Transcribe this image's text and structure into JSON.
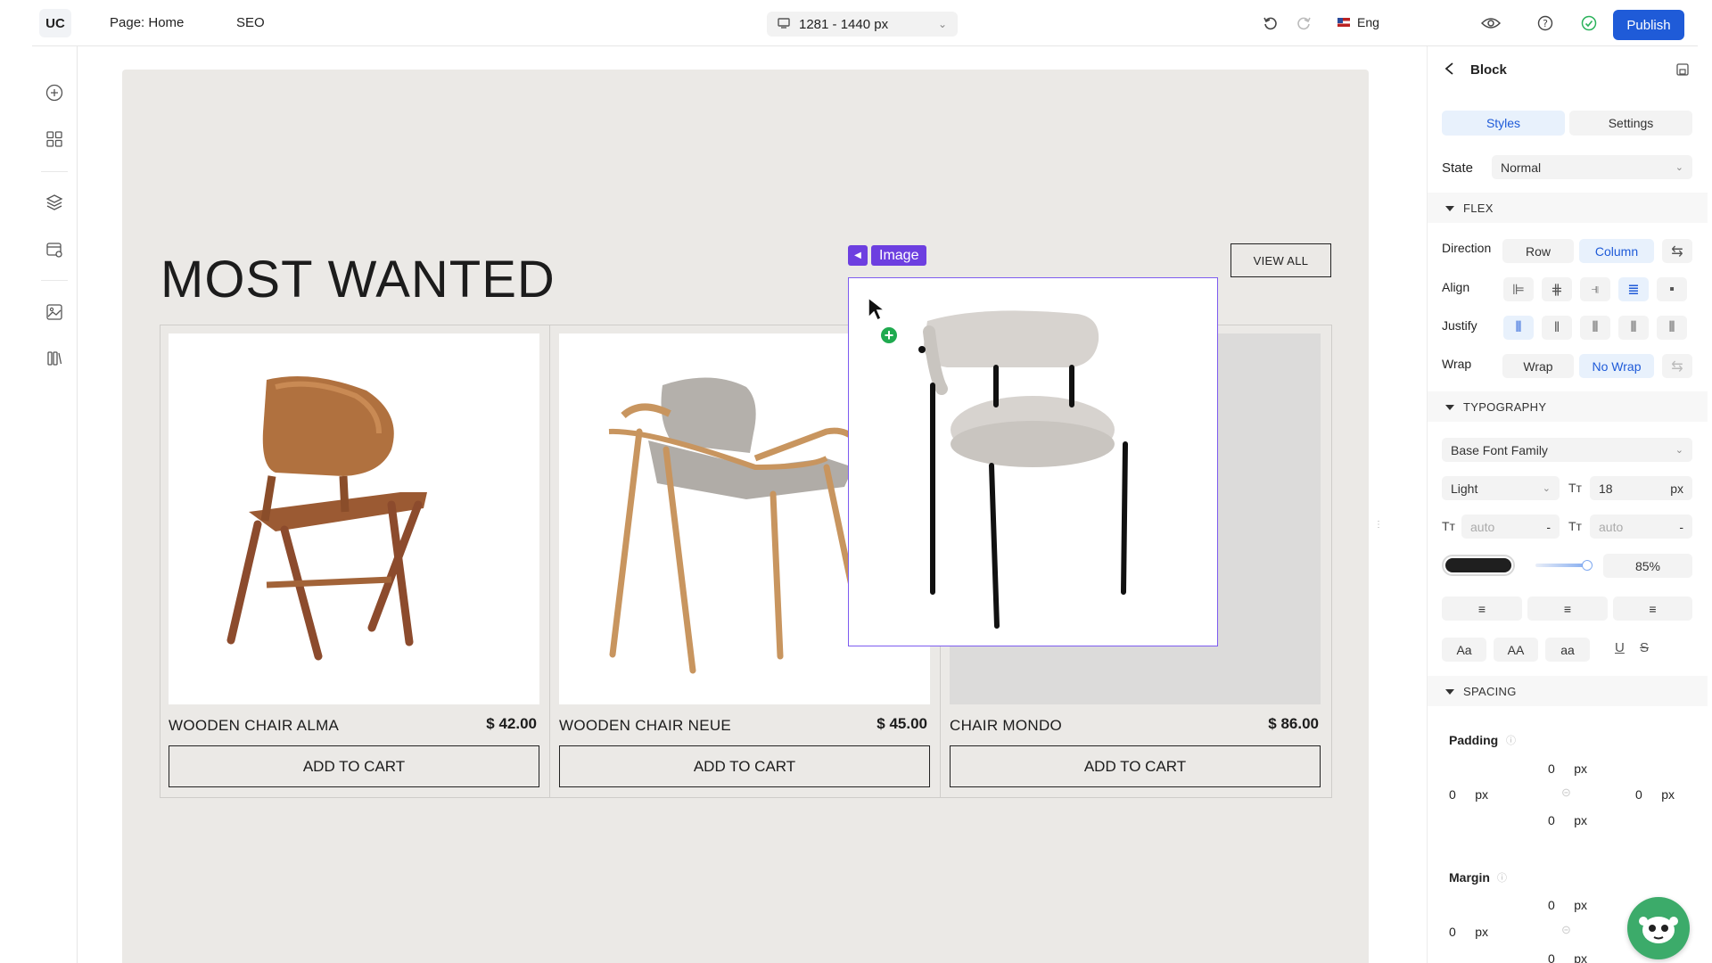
{
  "topbar": {
    "logo": "UC",
    "page_label": "Page: Home",
    "seo_label": "SEO",
    "resolution": "1281  - 1440 px",
    "language": "Eng",
    "publish_label": "Publish"
  },
  "canvas": {
    "section_title": "MOST WANTED",
    "view_all_label": "VIEW ALL",
    "selection_label": "Image",
    "products": [
      {
        "name": "WOODEN CHAIR ALMA",
        "price": "$ 42.00",
        "button": "ADD TO CART"
      },
      {
        "name": "WOODEN CHAIR NEUE",
        "price": "$ 45.00",
        "button": "ADD TO CART"
      },
      {
        "name": "CHAIR MONDO",
        "price": "$ 86.00",
        "button": "ADD TO CART"
      }
    ]
  },
  "panel": {
    "title": "Block",
    "tabs": {
      "styles": "Styles",
      "settings": "Settings"
    },
    "state_label": "State",
    "state_value": "Normal",
    "flex": {
      "section": "FLEX",
      "direction_label": "Direction",
      "direction_options": [
        "Row",
        "Column"
      ],
      "direction_selected": "Column",
      "align_label": "Align",
      "justify_label": "Justify",
      "wrap_label": "Wrap",
      "wrap_options": [
        "Wrap",
        "No Wrap"
      ],
      "wrap_selected": "No Wrap"
    },
    "typography": {
      "section": "TYPOGRAPHY",
      "font_family": "Base Font Family",
      "font_weight": "Light",
      "font_size": "18",
      "font_size_unit": "px",
      "line_height": "auto",
      "letter_spacing": "auto",
      "dash": "-",
      "color": "#1f1f1f",
      "opacity": "85%",
      "case_options": [
        "Aa",
        "AA",
        "aa"
      ]
    },
    "spacing": {
      "section": "SPACING",
      "padding_label": "Padding",
      "margin_label": "Margin",
      "unit": "px",
      "padding": {
        "top": "0",
        "left": "0",
        "right": "0",
        "bottom": "0"
      },
      "margin": {
        "top": "0",
        "left": "0",
        "bottom": "0"
      }
    }
  }
}
